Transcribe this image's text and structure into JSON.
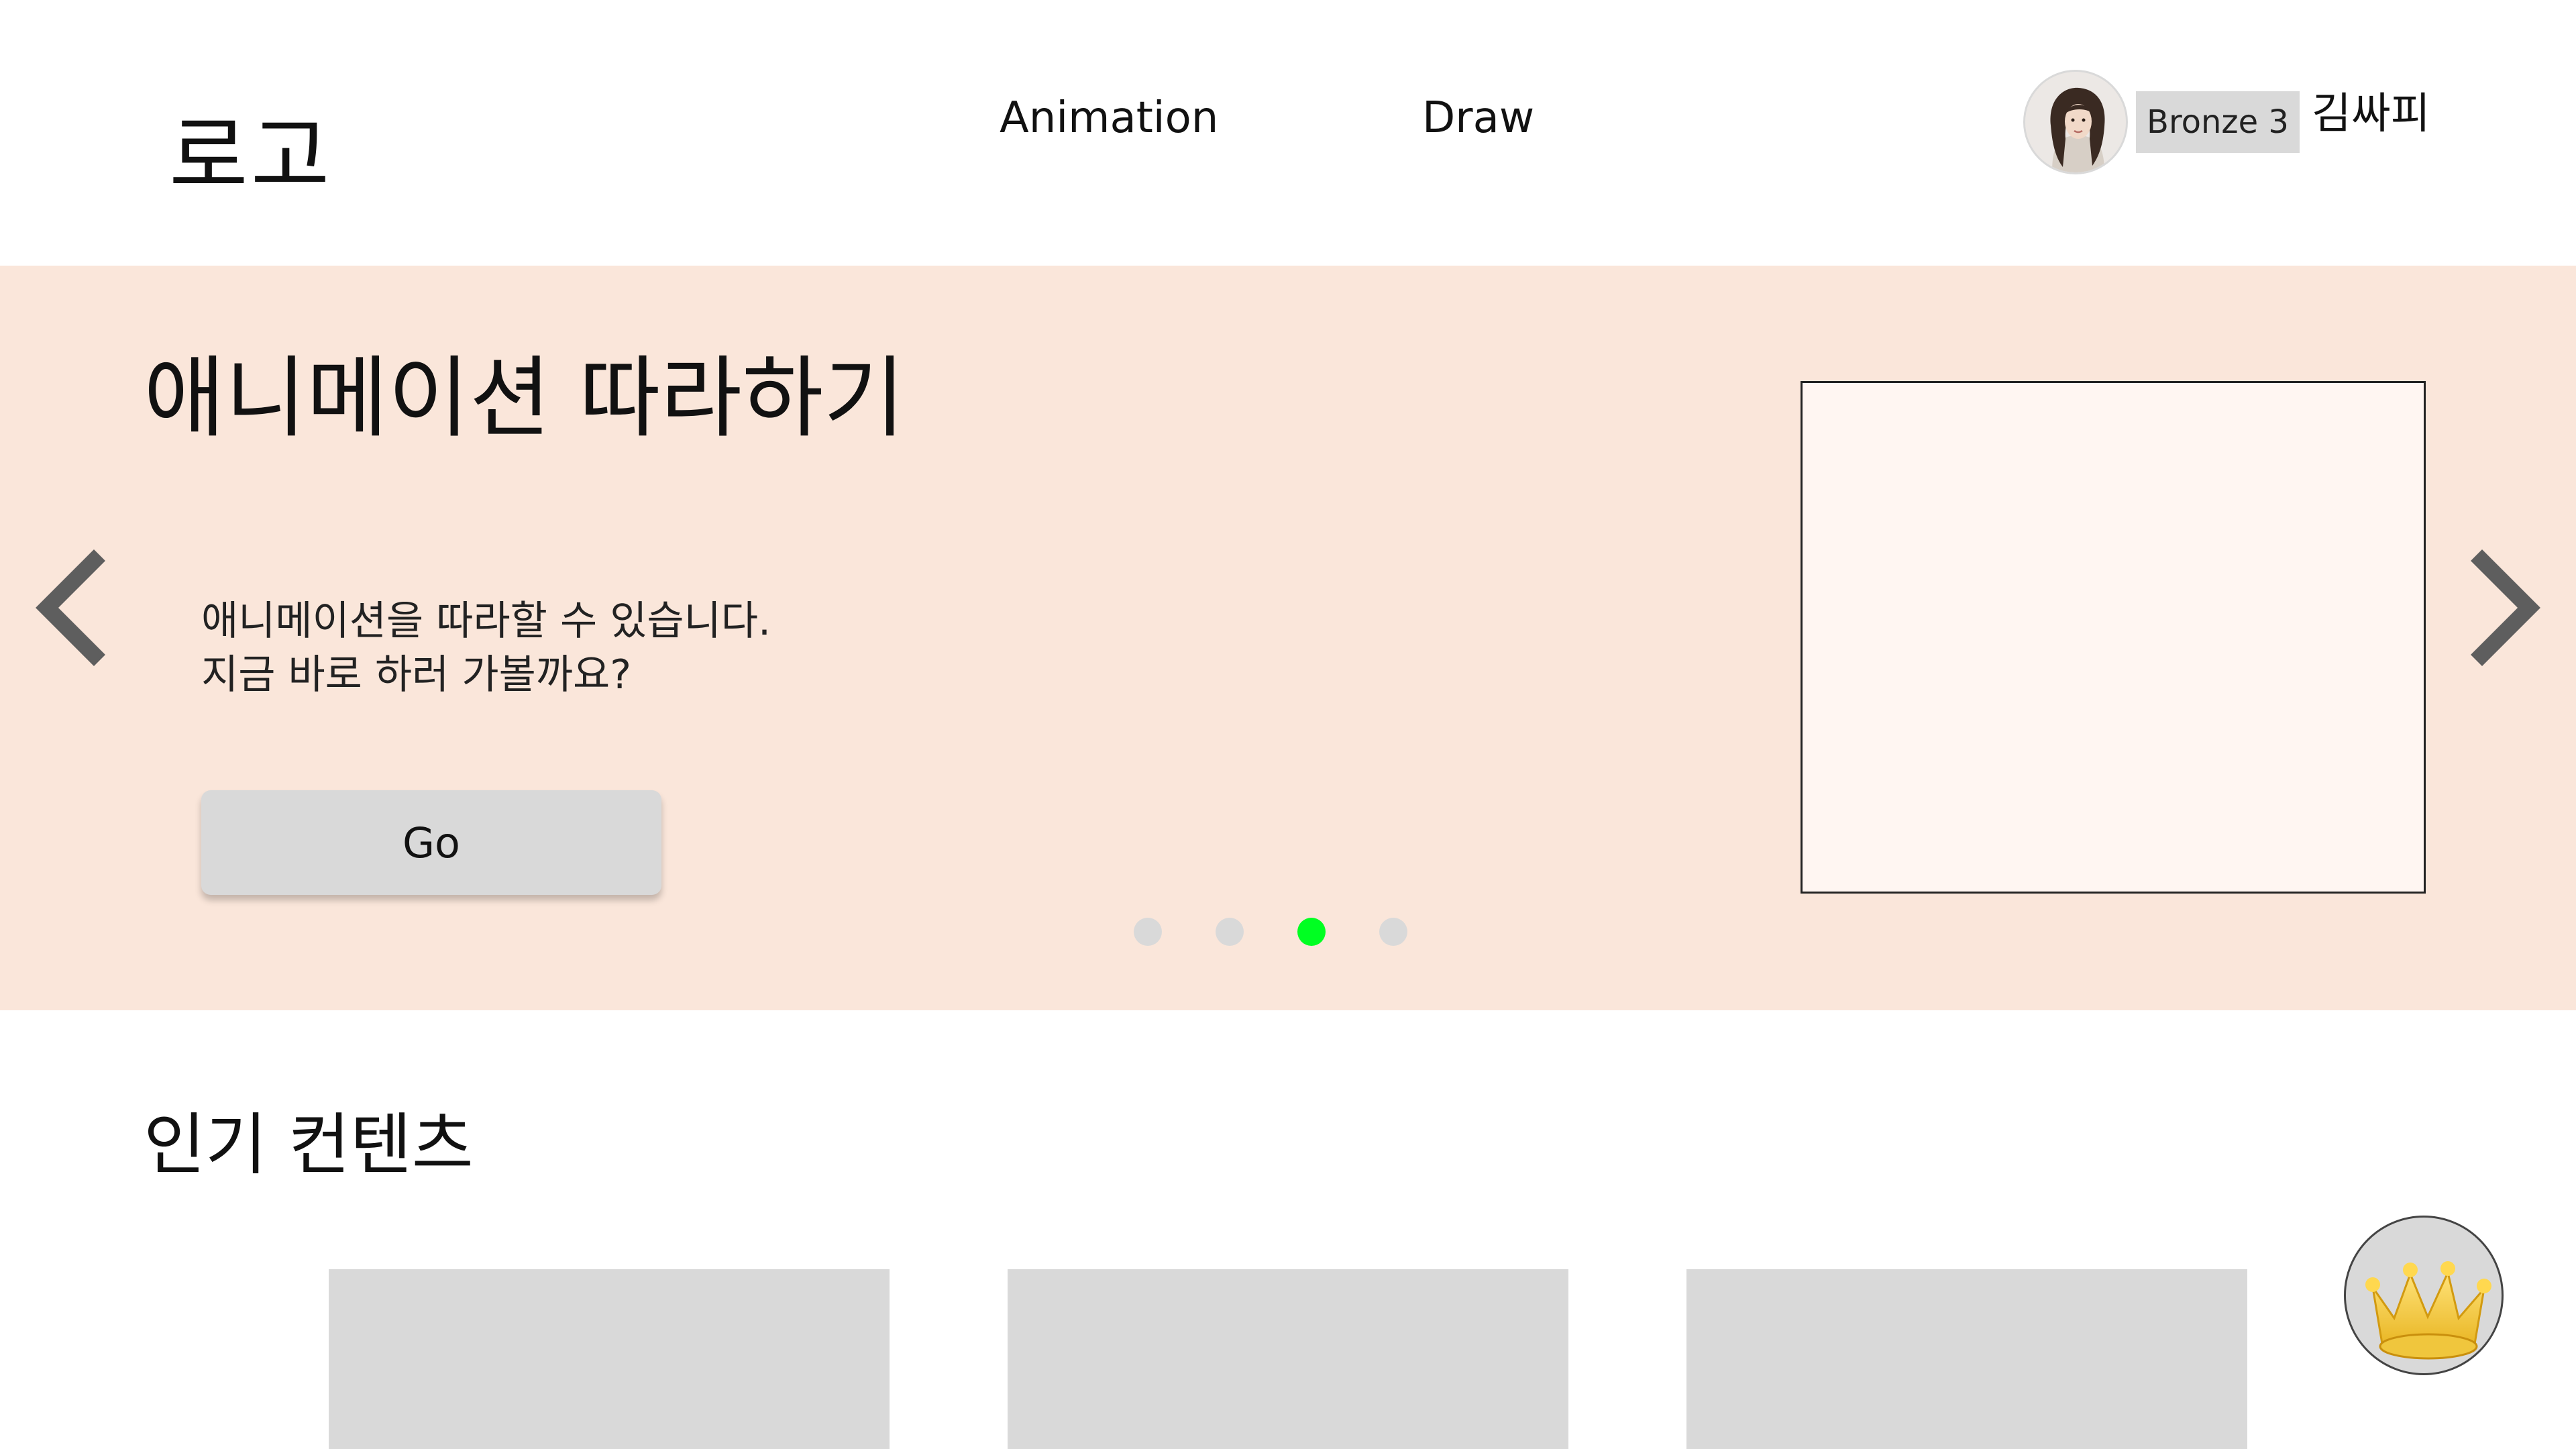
{
  "header": {
    "logo": "로고",
    "nav": [
      {
        "label": "Animation"
      },
      {
        "label": "Draw"
      }
    ],
    "user": {
      "rank": "Bronze 3",
      "name": "김싸피"
    }
  },
  "hero": {
    "title": "애니메이션 따라하기",
    "description_line1": "애니메이션을 따라할 수 있습니다.",
    "description_line2": "지금 바로 하러 가볼까요?",
    "button_label": "Go",
    "carousel": {
      "total": 4,
      "active_index": 3
    }
  },
  "popular": {
    "title": "인기 컨텐츠"
  },
  "colors": {
    "hero_bg": "#fae6da",
    "active_dot": "#00ff22",
    "inactive_dot": "#d9d9d9",
    "placeholder_gray": "#d9d9d9"
  }
}
